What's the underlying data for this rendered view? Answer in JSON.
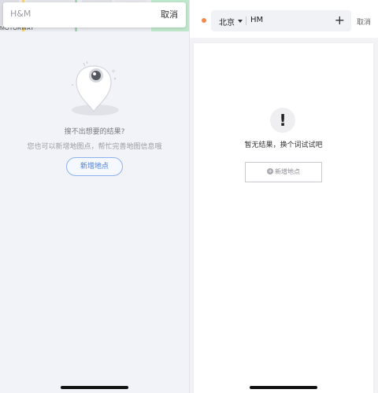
{
  "left_screen": {
    "map": {
      "road_label": "MOTORWAY"
    },
    "search": {
      "value": "H&M",
      "cancel_label": "取消"
    },
    "empty_state": {
      "title": "搜不出想要的结果?",
      "subtitle": "您也可以新增地图点，帮忙完善地图信息哦",
      "add_button_label": "新增地点"
    }
  },
  "right_screen": {
    "header": {
      "city": "北京",
      "query": "HM",
      "plus_symbol": "+",
      "cancel_label": "取消"
    },
    "empty_state": {
      "icon_symbol": "!",
      "message": "暂无结果，换个词试试吧",
      "add_button_label": "新增地点"
    }
  },
  "colors": {
    "accent_blue": "#4d7bd6",
    "location_dot": "#f28a4c",
    "left_background": "#f2f3f8"
  }
}
